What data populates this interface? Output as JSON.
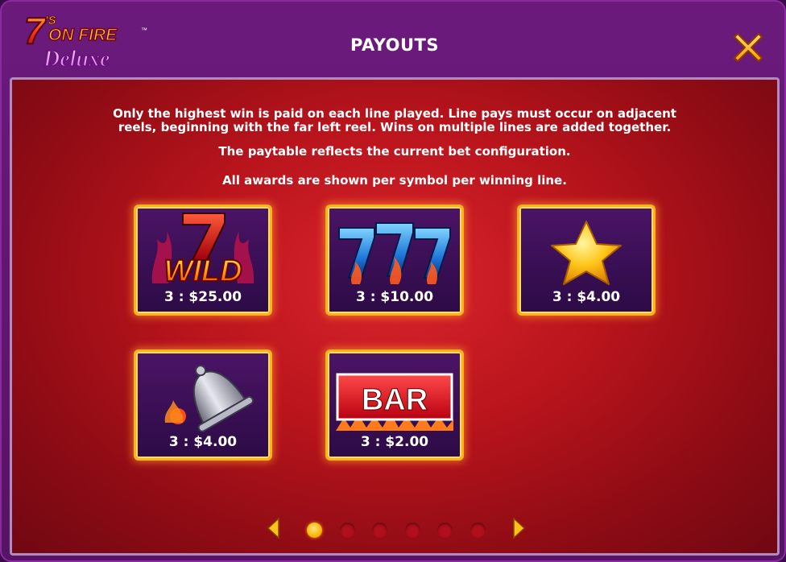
{
  "header": {
    "logo": {
      "line1": "7",
      "line1_sup": "'S",
      "line2": "ON FIRE",
      "tm": "™",
      "line3": "Deluxe"
    },
    "title": "PAYOUTS",
    "close_icon": "close-x-icon"
  },
  "rules": {
    "line1": "Only the highest win is paid on each line played. Line pays must occur on adjacent",
    "line2": "reels, beginning with the far left reel. Wins on multiple lines are added together.",
    "line3": "The paytable reflects the current bet configuration.",
    "line4": "All awards are shown per symbol per winning line."
  },
  "symbols": [
    {
      "name": "wild",
      "icon": "seven-wild-icon",
      "label": "WILD",
      "pay": "3 : $25.00"
    },
    {
      "name": "triple-seven",
      "icon": "triple-seven-icon",
      "label": "777",
      "pay": "3 : $10.00"
    },
    {
      "name": "star",
      "icon": "star-icon",
      "pay": "3 : $4.00"
    },
    {
      "name": "bell",
      "icon": "bell-icon",
      "pay": "3 : $4.00"
    },
    {
      "name": "bar",
      "icon": "bar-icon",
      "label": "BAR",
      "pay": "3 : $2.00"
    }
  ],
  "pagination": {
    "pages": 6,
    "current": 1,
    "prev_icon": "arrow-left-icon",
    "next_icon": "arrow-right-icon"
  },
  "colors": {
    "accent_gold": "#ffb21a",
    "panel_red": "#c41a22",
    "frame_purple": "#6b1a7c"
  }
}
